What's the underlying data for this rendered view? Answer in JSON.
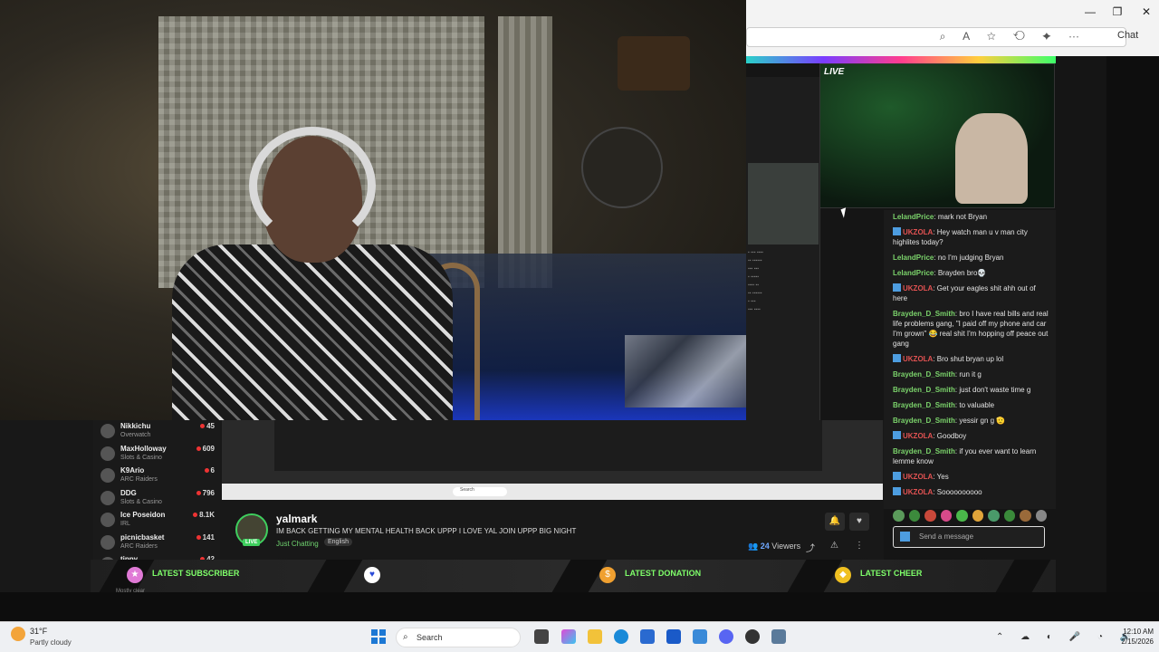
{
  "browser": {
    "chat_label": "Chat",
    "window_controls": [
      "—",
      "❐",
      "✕"
    ]
  },
  "overlay": {
    "live_label": "LIVE"
  },
  "chat": {
    "messages": [
      {
        "user": "LelandPrice",
        "color": "green",
        "badge": false,
        "text": "mark not Bryan"
      },
      {
        "user": "UKZOLA",
        "color": "red",
        "badge": true,
        "text": "Hey watch man u v man city highlites today?"
      },
      {
        "user": "LelandPrice",
        "color": "green",
        "badge": false,
        "text": "no I'm judging Bryan"
      },
      {
        "user": "LelandPrice",
        "color": "green",
        "badge": false,
        "text": "Brayden bro💀"
      },
      {
        "user": "UKZOLA",
        "color": "red",
        "badge": true,
        "text": "Get your eagles shit ahh out of here"
      },
      {
        "user": "Brayden_D_Smith",
        "color": "green",
        "badge": false,
        "text": "bro I have real bills and real life problems gang, \"I paid off my phone and car I'm grown\" 😂 real shit I'm hopping off peace out gang"
      },
      {
        "user": "UKZOLA",
        "color": "red",
        "badge": true,
        "text": "Bro shut bryan up lol"
      },
      {
        "user": "Brayden_D_Smith",
        "color": "green",
        "badge": false,
        "text": "run it g"
      },
      {
        "user": "Brayden_D_Smith",
        "color": "green",
        "badge": false,
        "text": "just don't waste time g"
      },
      {
        "user": "Brayden_D_Smith",
        "color": "green",
        "badge": false,
        "text": "to valuable"
      },
      {
        "user": "Brayden_D_Smith",
        "color": "green",
        "badge": false,
        "text": "yessir gn g 🫡"
      },
      {
        "user": "UKZOLA",
        "color": "red",
        "badge": true,
        "text": "Goodboy"
      },
      {
        "user": "Brayden_D_Smith",
        "color": "green",
        "badge": false,
        "text": "if you ever want to learn lemme know"
      },
      {
        "user": "UKZOLA",
        "color": "red",
        "badge": true,
        "text": "Yes"
      },
      {
        "user": "UKZOLA",
        "color": "red",
        "badge": true,
        "text": "Soooooooooo"
      }
    ],
    "input_placeholder": "Send a message"
  },
  "followers": [
    {
      "name": "Nikkichu",
      "category": "Overwatch",
      "count": "45"
    },
    {
      "name": "MaxHolloway",
      "category": "Slots & Casino",
      "count": "609"
    },
    {
      "name": "K9Ario",
      "category": "ARC Raiders",
      "count": "6"
    },
    {
      "name": "DDG",
      "category": "Slots & Casino",
      "count": "796"
    },
    {
      "name": "Ice Poseidon",
      "category": "IRL",
      "count": "8.1K"
    },
    {
      "name": "picnicbasket",
      "category": "ARC Raiders",
      "count": "141"
    },
    {
      "name": "tippy",
      "category": "",
      "count": "42"
    }
  ],
  "stream": {
    "streamer": "yalmark",
    "title": "IM BACK GETTING MY MENTAL HEALTH BACK UPPP I LOVE YAL JOIN UPPP BIG NIGHT",
    "category": "Just Chatting",
    "language": "English",
    "live_label": "LIVE",
    "viewers_count": "24",
    "viewers_label": "Viewers"
  },
  "alerts": {
    "subscriber": "LATEST SUBSCRIBER",
    "donation": "LATEST DONATION",
    "cheer": "LATEST CHEER"
  },
  "nested_weather": "Mostly clear",
  "taskbar": {
    "temperature": "31°F",
    "condition": "Partly cloudy",
    "search_label": "Search",
    "time": "12:10 AM",
    "date": "2/15/2026"
  }
}
